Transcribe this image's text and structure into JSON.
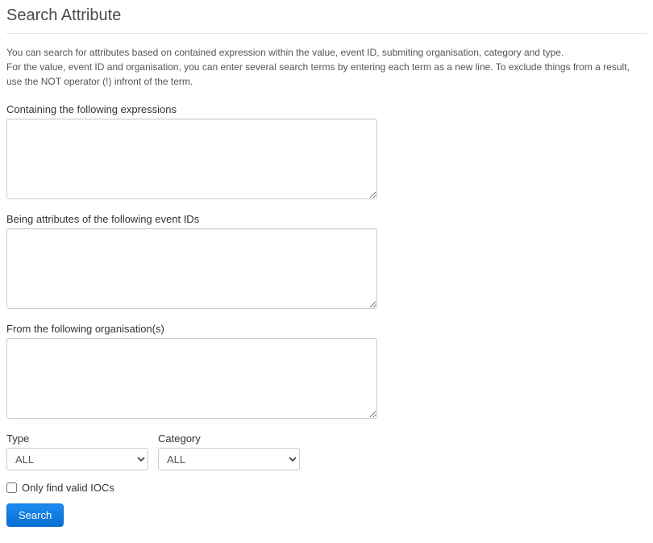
{
  "page": {
    "title": "Search Attribute"
  },
  "description": {
    "line1": "You can search for attributes based on contained expression within the value, event ID, submiting organisation, category and type.",
    "line2": "For the value, event ID and organisation, you can enter several search terms by entering each term as a new line. To exclude things from a result, use the NOT operator (!) infront of the term."
  },
  "fields": {
    "expressions": {
      "label": "Containing the following expressions",
      "value": ""
    },
    "event_ids": {
      "label": "Being attributes of the following event IDs",
      "value": ""
    },
    "organisations": {
      "label": "From the following organisation(s)",
      "value": ""
    },
    "type": {
      "label": "Type",
      "selected": "ALL"
    },
    "category": {
      "label": "Category",
      "selected": "ALL"
    },
    "only_iocs": {
      "label": "Only find valid IOCs",
      "checked": false
    }
  },
  "actions": {
    "search_label": "Search"
  }
}
